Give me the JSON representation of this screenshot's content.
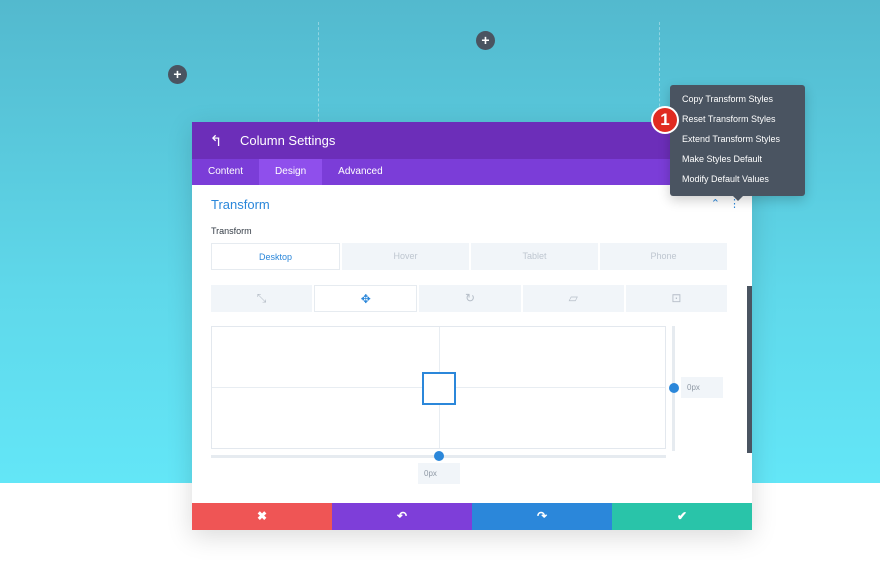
{
  "modal": {
    "title": "Column Settings",
    "tabs": [
      {
        "label": "Content"
      },
      {
        "label": "Design"
      },
      {
        "label": "Advanced"
      }
    ],
    "section_title": "Transform",
    "field_label": "Transform",
    "device_tabs": [
      {
        "label": "Desktop"
      },
      {
        "label": "Hover"
      },
      {
        "label": "Tablet"
      },
      {
        "label": "Phone"
      }
    ],
    "mode_tabs": [
      {
        "icon": "scale-icon",
        "glyph": "⤡"
      },
      {
        "icon": "translate-icon",
        "glyph": "✥"
      },
      {
        "icon": "rotate-icon",
        "glyph": "↻"
      },
      {
        "icon": "skew-icon",
        "glyph": "▱"
      },
      {
        "icon": "origin-icon",
        "glyph": "⊡"
      }
    ],
    "vertical_value": "0px",
    "horizontal_value": "0px",
    "footer": {
      "cancel_glyph": "✖",
      "undo_glyph": "↶",
      "redo_glyph": "↷",
      "save_glyph": "✔"
    }
  },
  "context_menu": {
    "items": [
      {
        "label": "Copy Transform Styles"
      },
      {
        "label": "Reset Transform Styles"
      },
      {
        "label": "Extend Transform Styles"
      },
      {
        "label": "Make Styles Default"
      },
      {
        "label": "Modify Default Values"
      }
    ]
  },
  "step_badge": "1",
  "glyphs": {
    "plus": "+",
    "back": "↰",
    "collapse": "⌃",
    "more": "⋮"
  },
  "colors": {
    "header": "#6c2eb9",
    "tabs": "#7b3dd8",
    "accent": "#2b87da",
    "cancel": "#ef5555",
    "undo": "#7e3ed9",
    "redo": "#2b87da",
    "save": "#29c4a9",
    "menu": "#4a5461",
    "badge": "#e02b20"
  }
}
